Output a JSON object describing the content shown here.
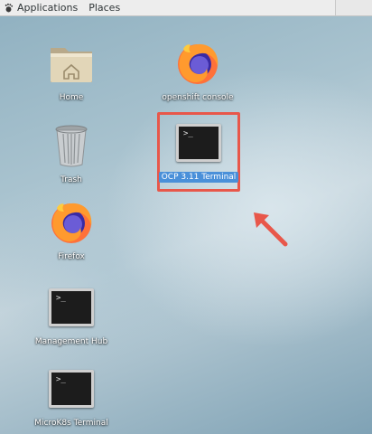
{
  "topbar": {
    "applications_label": "Applications",
    "places_label": "Places"
  },
  "desktop": {
    "items": [
      {
        "label": "Home",
        "icon": "home-folder-icon"
      },
      {
        "label": "openshift console",
        "icon": "firefox-icon"
      },
      {
        "label": "Trash",
        "icon": "trash-icon"
      },
      {
        "label": "OCP 3.11 Terminal",
        "icon": "terminal-icon",
        "selected": true
      },
      {
        "label": "Firefox",
        "icon": "firefox-icon"
      },
      {
        "label": "Management Hub",
        "icon": "terminal-icon"
      },
      {
        "label": "MicroK8s Terminal",
        "icon": "terminal-icon"
      }
    ]
  },
  "terminal_prompt": ">_",
  "colors": {
    "highlight": "#e8574a",
    "selection": "#4a90d9",
    "topbar": "#ededed"
  }
}
